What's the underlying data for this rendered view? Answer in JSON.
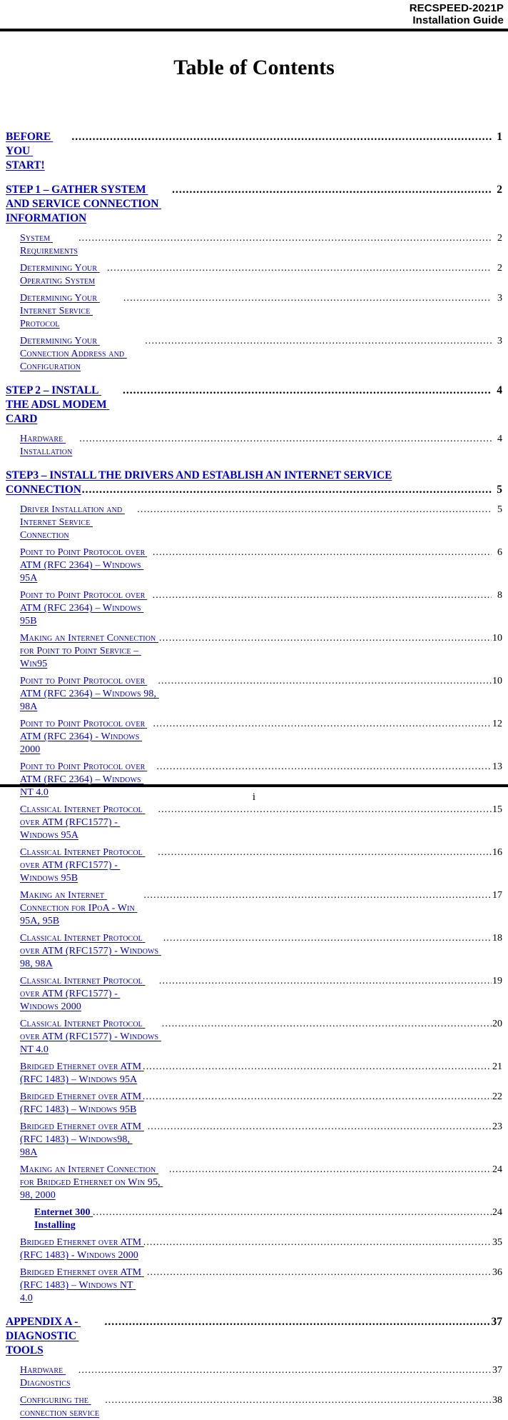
{
  "header": {
    "line1": "RECSPEED-2021P",
    "line2": "Installation Guide"
  },
  "title": "Table of Contents",
  "colors": {
    "link": "#0000CC",
    "text": "#000000",
    "rule": "#000000"
  },
  "footer": {
    "page_number": "i"
  },
  "toc": {
    "entries": [
      {
        "level": 1,
        "label": "BEFORE YOU START!",
        "page": "1"
      },
      {
        "level": 1,
        "label": "STEP 1 – GATHER SYSTEM AND SERVICE CONNECTION INFORMATION",
        "page": "2"
      },
      {
        "level": 2,
        "label": "System Requirements",
        "page": "2"
      },
      {
        "level": 2,
        "label": "Determining Your Operating System",
        "page": "2"
      },
      {
        "level": 2,
        "label": "Determining Your Internet Service Protocol",
        "page": "3"
      },
      {
        "level": 2,
        "label": "Determining Your Connection Address and Configuration",
        "page": "3"
      },
      {
        "level": 1,
        "label": "STEP 2 – INSTALL THE ADSL MODEM CARD",
        "page": "4"
      },
      {
        "level": 2,
        "label": "Hardware Installation",
        "page": "4"
      },
      {
        "level": 1,
        "label": "STEP3 – INSTALL THE DRIVERS AND ESTABLISH AN INTERNET SERVICE CONNECTION",
        "page": "5",
        "line1": "STEP3 – INSTALL THE DRIVERS AND ESTABLISH AN INTERNET SERVICE",
        "line2": "CONNECTION"
      },
      {
        "level": 2,
        "label": "Driver Installation and Internet Service Connection",
        "page": "5"
      },
      {
        "level": 2,
        "label": "Point to Point Protocol over ATM (RFC 2364) – Windows 95A",
        "page": "6"
      },
      {
        "level": 2,
        "label": "Point to Point Protocol over ATM (RFC 2364) – Windows 95B",
        "page": "8"
      },
      {
        "level": 2,
        "label": "Making an Internet Connection for Point to Point Service – Win95",
        "page": "10"
      },
      {
        "level": 2,
        "label": "Point to Point Protocol over ATM (RFC 2364) – Windows 98, 98A",
        "page": "10"
      },
      {
        "level": 2,
        "label": "Point to Point Protocol over ATM (RFC 2364) - Windows 2000",
        "page": "12"
      },
      {
        "level": 2,
        "label": "Point to Point Protocol over ATM (RFC 2364) – Windows NT 4.0",
        "page": "13"
      },
      {
        "level": 2,
        "label": "Classical Internet Protocol over ATM (RFC1577) - Windows 95A",
        "page": "15"
      },
      {
        "level": 2,
        "label": "Classical Internet Protocol over ATM (RFC1577) - Windows 95B",
        "page": "16"
      },
      {
        "level": 2,
        "label": "Making an Internet Connection for IPoA - Win 95A, 95B",
        "page": "17"
      },
      {
        "level": 2,
        "label": "Classical Internet Protocol over ATM (RFC1577) - Windows 98, 98A",
        "page": "18"
      },
      {
        "level": 2,
        "label": "Classical Internet Protocol over ATM (RFC1577) - Windows 2000",
        "page": "19"
      },
      {
        "level": 2,
        "label": "Classical Internet Protocol over ATM (RFC1577) - Windows NT 4.0",
        "page": "20"
      },
      {
        "level": 2,
        "label": "Bridged Ethernet over ATM (RFC 1483) – Windows 95A",
        "page": "21"
      },
      {
        "level": 2,
        "label": "Bridged Ethernet over ATM (RFC 1483) – Windows 95B",
        "page": "22"
      },
      {
        "level": 2,
        "label": "Bridged Ethernet over ATM (RFC 1483) – Windows98, 98A",
        "page": "23"
      },
      {
        "level": 2,
        "label": "Making an Internet Connection for Bridged Ethernet on Win 95, 98, 2000",
        "page": "24"
      },
      {
        "level": 3,
        "label": "Enternet 300 Installing",
        "page": "24"
      },
      {
        "level": 2,
        "label": "Bridged Ethernet over ATM (RFC 1483) - Windows 2000",
        "page": "35"
      },
      {
        "level": 2,
        "label": "Bridged Ethernet over ATM (RFC 1483) – Windows NT 4.0",
        "page": "36"
      },
      {
        "level": 1,
        "label": "APPENDIX A - DIAGNOSTIC TOOLS",
        "page": "37"
      },
      {
        "level": 2,
        "label": "Hardware Diagnostics",
        "page": "37"
      },
      {
        "level": 2,
        "label": "Configuring the connection service",
        "page": "38"
      }
    ]
  }
}
